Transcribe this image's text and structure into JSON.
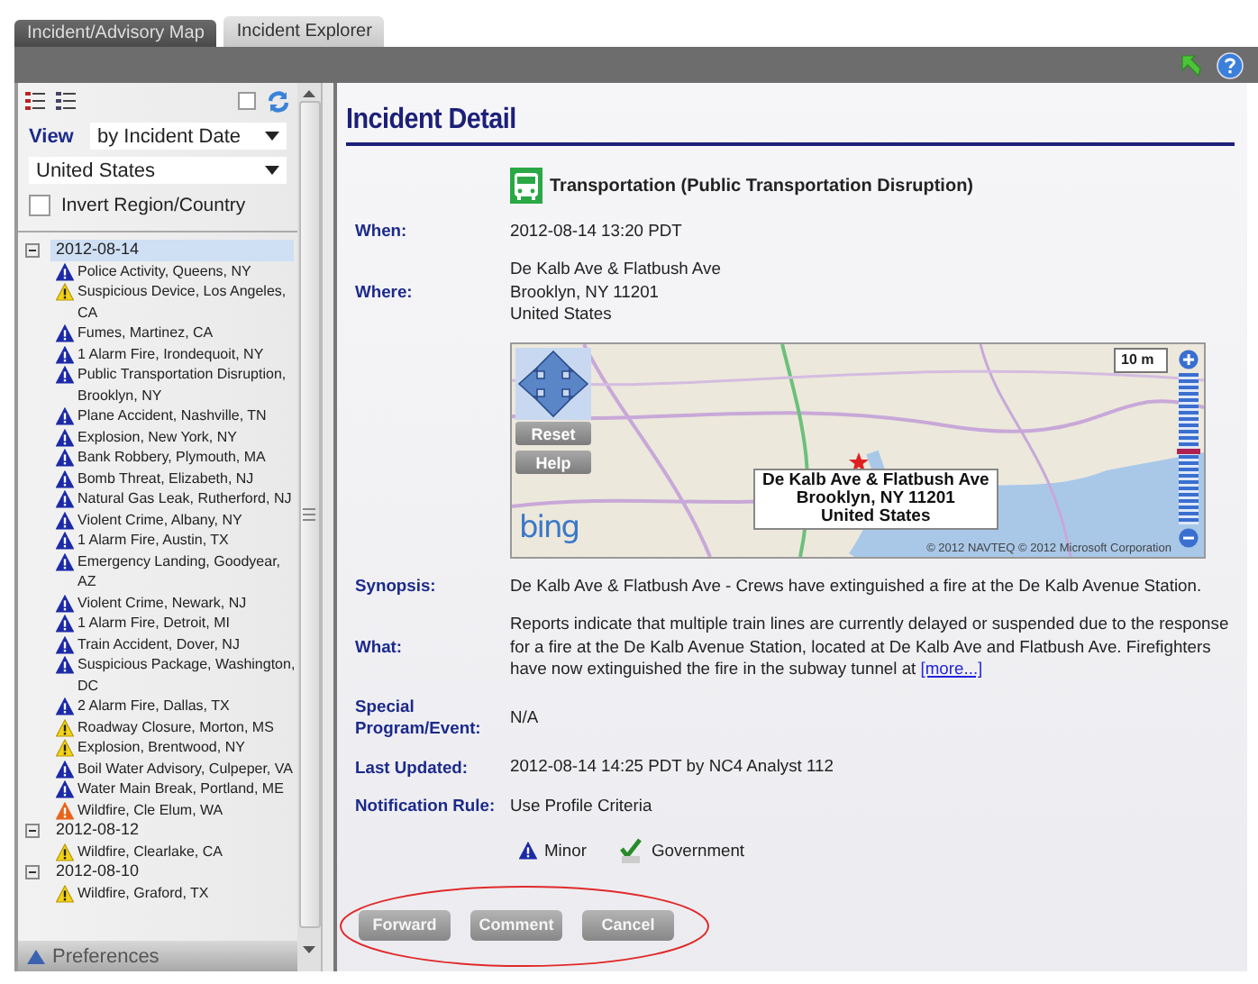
{
  "tabs": [
    {
      "label": "Incident/Advisory Map",
      "selected": false
    },
    {
      "label": "Incident Explorer",
      "selected": true
    }
  ],
  "sidebar": {
    "toolbar_checkbox": {
      "checked": false
    },
    "view_label": "View",
    "view_select": "by Incident Date",
    "region_select": "United States",
    "invert_checkbox": {
      "label": "Invert Region/Country",
      "checked": false
    },
    "groups": [
      {
        "date": "2012-08-14",
        "expanded": true,
        "selected": true,
        "children": [
          {
            "label": "Police Activity, Queens, NY",
            "color": "#1c2aa8"
          },
          {
            "label": "Suspicious Device, Los Angeles, CA",
            "color": "#f2d21a"
          },
          {
            "label": "Fumes, Martinez, CA",
            "color": "#1c2aa8"
          },
          {
            "label": "1 Alarm Fire, Irondequoit, NY",
            "color": "#1c2aa8"
          },
          {
            "label": "Public Transportation Disruption, Brooklyn, NY",
            "color": "#1c2aa8"
          },
          {
            "label": "Plane Accident, Nashville, TN",
            "color": "#1c2aa8"
          },
          {
            "label": "Explosion, New York, NY",
            "color": "#1c2aa8"
          },
          {
            "label": "Bank Robbery, Plymouth, MA",
            "color": "#1c2aa8"
          },
          {
            "label": "Bomb Threat, Elizabeth, NJ",
            "color": "#1c2aa8"
          },
          {
            "label": "Natural Gas Leak, Rutherford, NJ",
            "color": "#1c2aa8"
          },
          {
            "label": "Violent Crime, Albany, NY",
            "color": "#1c2aa8"
          },
          {
            "label": "1 Alarm Fire, Austin, TX",
            "color": "#1c2aa8"
          },
          {
            "label": "Emergency Landing, Goodyear, AZ",
            "color": "#1c2aa8"
          },
          {
            "label": "Violent Crime, Newark, NJ",
            "color": "#1c2aa8"
          },
          {
            "label": "1 Alarm Fire, Detroit, MI",
            "color": "#1c2aa8"
          },
          {
            "label": "Train Accident, Dover, NJ",
            "color": "#1c2aa8"
          },
          {
            "label": "Suspicious Package, Washington, DC",
            "color": "#1c2aa8"
          },
          {
            "label": "2 Alarm Fire, Dallas, TX",
            "color": "#1c2aa8"
          },
          {
            "label": "Roadway Closure, Morton, MS",
            "color": "#f2d21a"
          },
          {
            "label": "Explosion, Brentwood, NY",
            "color": "#f2d21a"
          },
          {
            "label": "Boil Water Advisory, Culpeper, VA",
            "color": "#1c2aa8"
          },
          {
            "label": "Water Main Break, Portland, ME",
            "color": "#1c2aa8"
          },
          {
            "label": "Wildfire, Cle Elum, WA",
            "color": "#e8641c"
          }
        ]
      },
      {
        "date": "2012-08-12",
        "expanded": true,
        "selected": false,
        "children": [
          {
            "label": "Wildfire, Clearlake, CA",
            "color": "#f2d21a"
          }
        ]
      },
      {
        "date": "2012-08-10",
        "expanded": true,
        "selected": false,
        "children": [
          {
            "label": "Wildfire, Graford, TX",
            "color": "#f2d21a"
          }
        ]
      }
    ],
    "footer": "Preferences"
  },
  "detail": {
    "title": "Incident Detail",
    "category": "Transportation (Public Transportation Disruption)",
    "fields": [
      {
        "kind": "text",
        "label": "When:",
        "value": "2012-08-14 13:20 PDT"
      },
      {
        "kind": "lines",
        "label": "Where:",
        "lines": [
          "De Kalb Ave & Flatbush Ave",
          "Brooklyn, NY 11201",
          "United States"
        ]
      },
      {
        "kind": "map",
        "reset": "Reset",
        "help": "Help",
        "popup": [
          "De Kalb Ave & Flatbush Ave",
          "Brooklyn, NY 11201",
          "United States"
        ],
        "logo": "bing",
        "copyright": "© 2012 NAVTEQ © 2012 Microsoft Corporation",
        "scale": "10 m",
        "zoom": {
          "level": 0.47
        }
      },
      {
        "kind": "text",
        "label": "Synopsis:",
        "value": "De Kalb Ave & Flatbush Ave - Crews have extinguished a fire at the De Kalb Avenue Station."
      },
      {
        "kind": "paragraph",
        "label": "What:",
        "value": "Reports indicate that multiple train lines are currently delayed or suspended due to the response for a fire at the De Kalb Avenue Station, located at De Kalb Ave and Flatbush Ave. Firefighters have now extinguished the fire in the subway tunnel at",
        "link": "[more...]"
      },
      {
        "kind": "text",
        "label": "Special Program/Event:",
        "value": "N/A"
      },
      {
        "kind": "text",
        "label": "Last Updated:",
        "value": "2012-08-14 14:25 PDT by NC4 Analyst 112"
      },
      {
        "kind": "text",
        "label": "Notification Rule:",
        "value": "Use Profile Criteria"
      }
    ],
    "legend": [
      {
        "kind": "severity",
        "label": "Minor"
      },
      {
        "kind": "audience",
        "label": "Government"
      }
    ],
    "buttons": [
      "Forward",
      "Comment",
      "Cancel"
    ]
  }
}
